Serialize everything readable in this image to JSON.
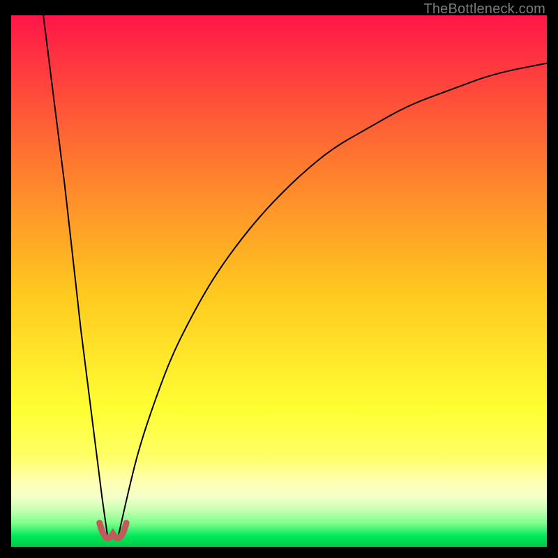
{
  "watermark": "TheBottleneck.com",
  "colors": {
    "frame": "#000000",
    "gradient_top": "#ff1648",
    "gradient_mid_upper": "#ff7a2f",
    "gradient_mid": "#ffc81f",
    "gradient_mid_lower": "#ffff33",
    "gradient_pale": "#ffffb0",
    "gradient_green": "#00e85a",
    "curve_stroke": "#000000",
    "bump_fill": "#c25a5a"
  },
  "chart_data": {
    "type": "line",
    "title": "",
    "xlabel": "",
    "ylabel": "",
    "xlim": [
      0,
      100
    ],
    "ylim": [
      0,
      100
    ],
    "series": [
      {
        "name": "left-descent",
        "x": [
          6,
          7,
          8,
          9,
          10,
          11,
          12,
          13,
          14,
          15,
          16,
          17,
          18
        ],
        "values": [
          100,
          92,
          84,
          76,
          68,
          59,
          50,
          41,
          33,
          25,
          17,
          9,
          2
        ]
      },
      {
        "name": "right-ascent",
        "x": [
          20,
          22,
          24,
          27,
          30,
          34,
          38,
          43,
          48,
          54,
          60,
          67,
          74,
          82,
          90,
          100
        ],
        "values": [
          2,
          11,
          19,
          28,
          36,
          44,
          51,
          58,
          64,
          70,
          75,
          79,
          83,
          86,
          89,
          91
        ]
      }
    ],
    "annotations": [
      {
        "name": "valley-bump",
        "x": 19,
        "y": 1.5,
        "width": 2.5,
        "height": 3
      }
    ]
  }
}
